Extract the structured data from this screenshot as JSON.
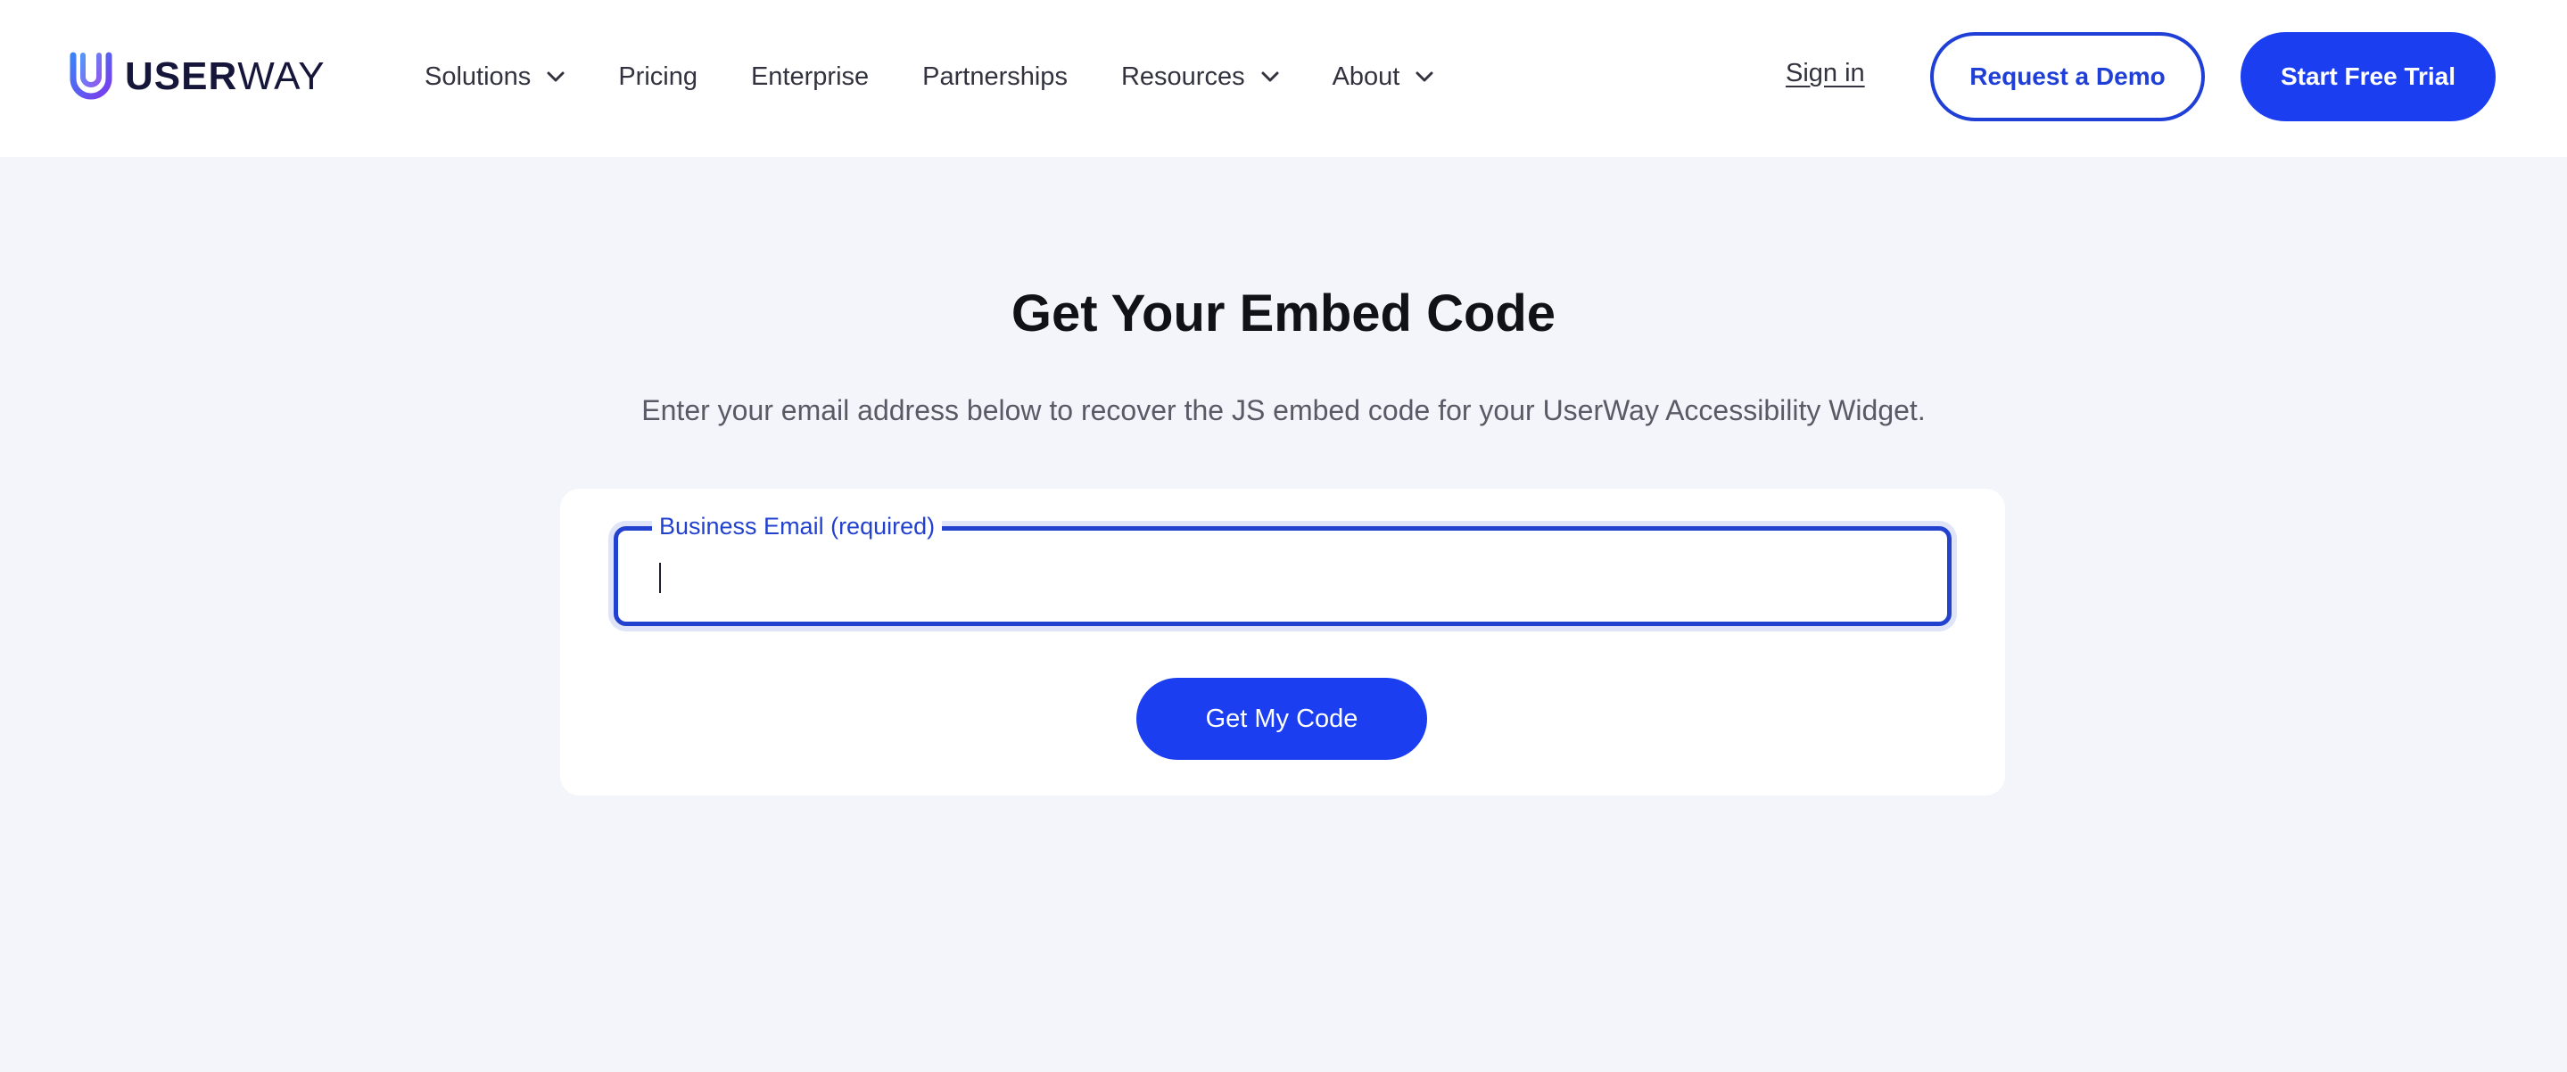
{
  "brand": {
    "name_bold": "USER",
    "name_light": "WAY",
    "logo_icon": "userway-u-logo-icon",
    "colors": {
      "primary": "#1b3ff0",
      "primary_dark": "#1f3fd6",
      "gradient_start": "#3b82f6",
      "gradient_end": "#7c3aed"
    }
  },
  "nav": {
    "items": [
      {
        "label": "Solutions",
        "has_dropdown": true
      },
      {
        "label": "Pricing",
        "has_dropdown": false
      },
      {
        "label": "Enterprise",
        "has_dropdown": false
      },
      {
        "label": "Partnerships",
        "has_dropdown": false
      },
      {
        "label": "Resources",
        "has_dropdown": true
      },
      {
        "label": "About",
        "has_dropdown": true
      }
    ],
    "sign_in": "Sign in",
    "request_demo": "Request a Demo",
    "start_trial": "Start Free Trial"
  },
  "main": {
    "title": "Get Your Embed Code",
    "subtitle": "Enter your email address below to recover the JS embed code for your UserWay Accessibility Widget.",
    "email_field": {
      "label": "Business Email (required)",
      "value": "",
      "placeholder": ""
    },
    "submit_label": "Get My Code"
  }
}
